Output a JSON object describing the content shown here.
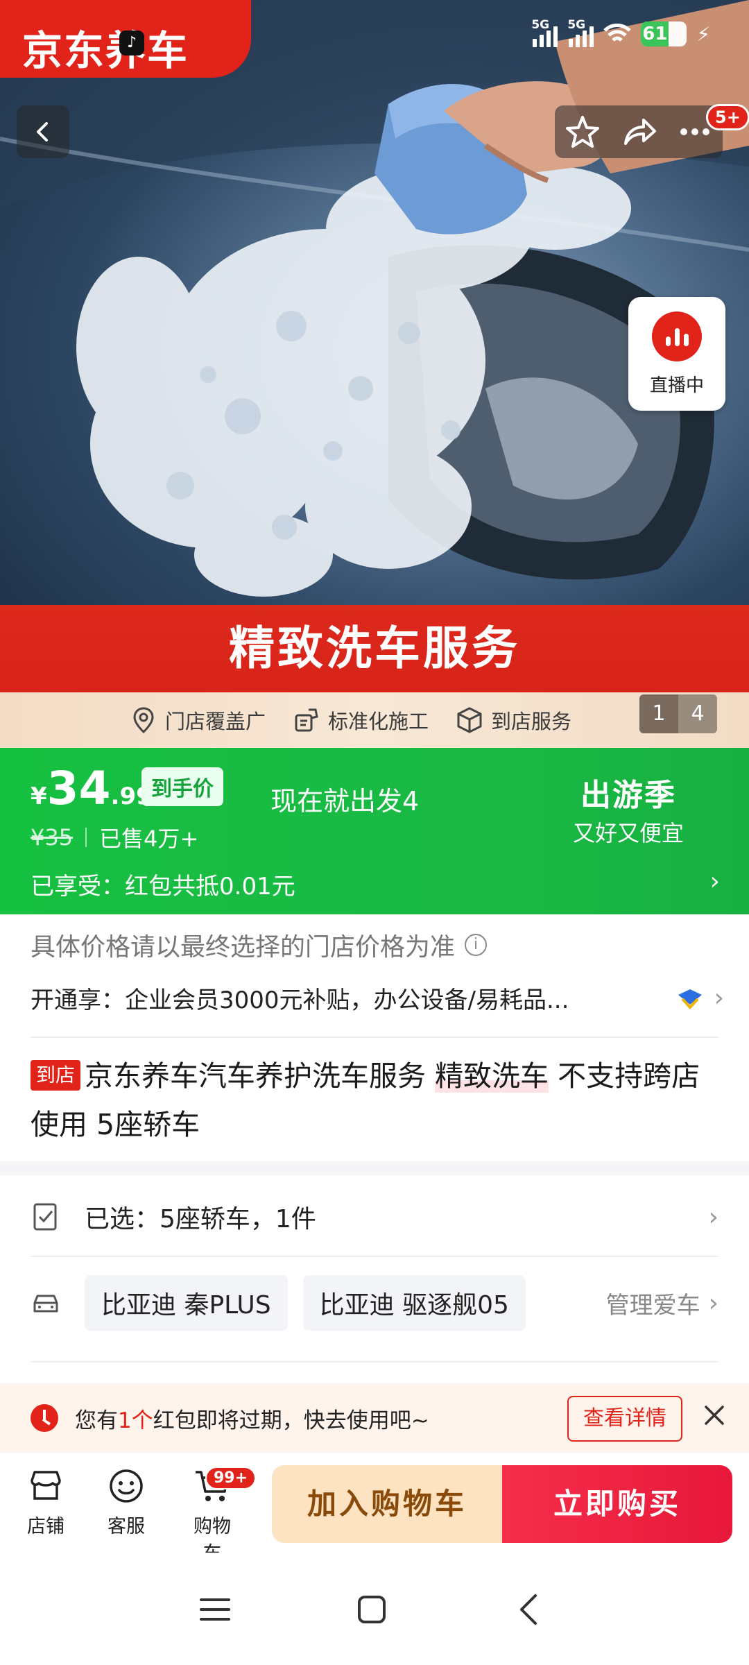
{
  "status_bar": {
    "brand": "京东养车",
    "signal1": "5G",
    "signal2": "5G",
    "battery": "61"
  },
  "hero": {
    "image_desc": "car-wash-sponge-foam",
    "live_label": "直播中",
    "message_badge": "5+",
    "banner_title": "精致洗车服务",
    "features": [
      "门店覆盖广",
      "标准化施工",
      "到店服务"
    ],
    "pager_current": "1",
    "pager_total": "4"
  },
  "price": {
    "currency": "¥",
    "integer": "34",
    "decimal": ".99",
    "tag": "到手价",
    "original": "¥35",
    "sold": "已售4万+",
    "promo_center": "现在就出发4",
    "promo_title": "出游季",
    "promo_sub": "又好又便宜",
    "enjoy": "已享受：红包共抵0.01元"
  },
  "info": {
    "note": "具体价格请以最终选择的门店价格为准",
    "member": "开通享：企业会员3000元补贴，办公设备/易耗品...",
    "store_tag": "到店",
    "title_a": "京东养车汽车养护洗车服务 ",
    "title_hl": "精致洗车",
    "title_b": " 不支持跨店使用 5座轿车"
  },
  "selection": {
    "selected": "已选：5座轿车，1件",
    "cars": [
      "比亚迪 秦PLUS",
      "比亚迪 驱逐舰05"
    ],
    "manage": "管理爱车"
  },
  "notice": {
    "pre": "您有",
    "count": "1个",
    "post": "红包即将过期，快去使用吧~",
    "button": "查看详情"
  },
  "bottom_bar": {
    "store": "店铺",
    "service": "客服",
    "cart": "购物车",
    "cart_badge": "99+",
    "add_to_cart": "加入购物车",
    "buy_now": "立即购买"
  },
  "colors": {
    "brand_red": "#e2231a",
    "price_green": "#1ab845",
    "buy_pink": "#f52e4a",
    "cart_beige": "#fde3c1"
  }
}
